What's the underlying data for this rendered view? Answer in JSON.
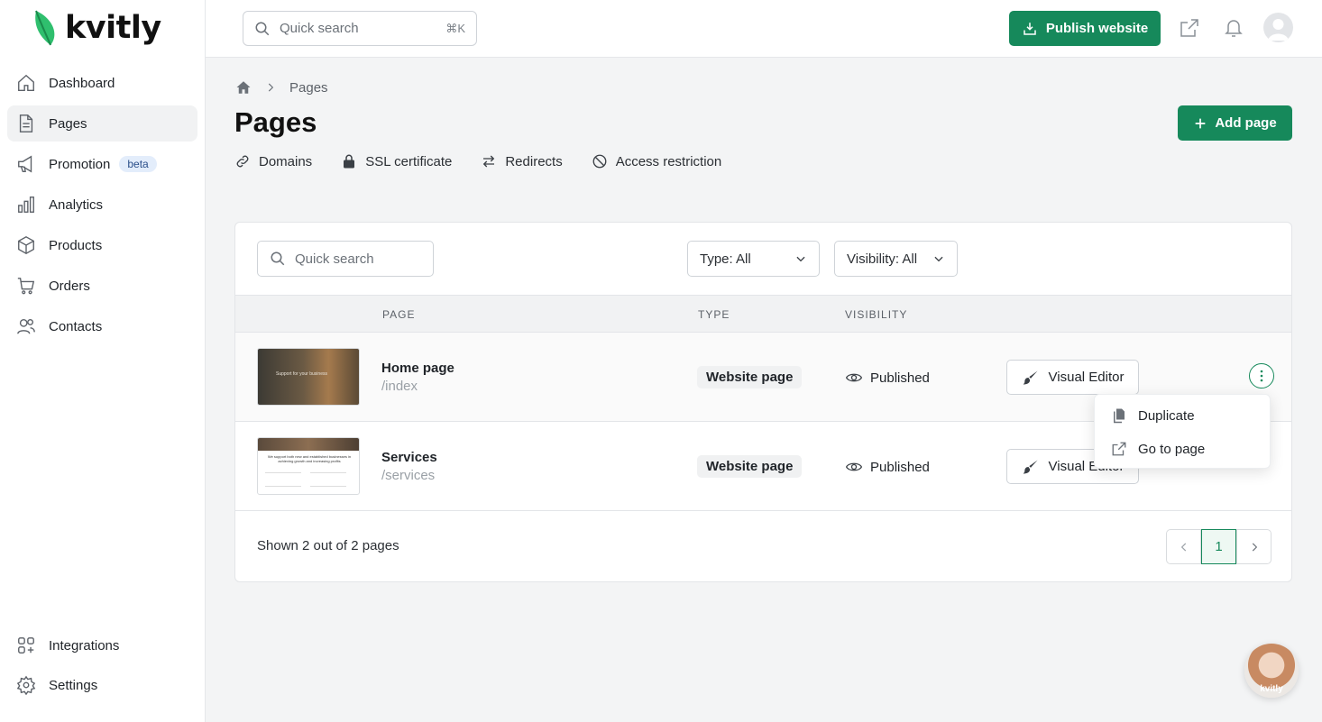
{
  "brand": {
    "name": "kvitly"
  },
  "sidebar": {
    "items": [
      {
        "label": "Dashboard"
      },
      {
        "label": "Pages"
      },
      {
        "label": "Promotion",
        "badge": "beta"
      },
      {
        "label": "Analytics"
      },
      {
        "label": "Products"
      },
      {
        "label": "Orders"
      },
      {
        "label": "Contacts"
      }
    ],
    "bottom": [
      {
        "label": "Integrations"
      },
      {
        "label": "Settings"
      }
    ]
  },
  "topbar": {
    "search_placeholder": "Quick search",
    "shortcut": "⌘K",
    "publish_label": "Publish website"
  },
  "breadcrumb": {
    "current": "Pages"
  },
  "page": {
    "title": "Pages",
    "add_label": "Add page",
    "subnav": [
      "Domains",
      "SSL certificate",
      "Redirects",
      "Access restriction"
    ]
  },
  "table": {
    "search_placeholder": "Quick search",
    "filters": {
      "type": "Type: All",
      "visibility": "Visibility: All"
    },
    "columns": [
      "PAGE",
      "TYPE",
      "VISIBILITY"
    ],
    "rows": [
      {
        "name": "Home page",
        "path": "/index",
        "type": "Website page",
        "visibility": "Published",
        "action": "Visual Editor",
        "thumb_text": "Support for your business"
      },
      {
        "name": "Services",
        "path": "/services",
        "type": "Website page",
        "visibility": "Published",
        "action": "Visual Editor",
        "thumb_text": "We support both new and established businesses in achieving growth and increasing profits"
      }
    ],
    "footer": "Shown 2 out of 2 pages",
    "pagination": {
      "current": "1"
    }
  },
  "row_menu": {
    "items": [
      "Duplicate",
      "Go to page"
    ]
  },
  "support_widget": {
    "label": "kvitly"
  },
  "colors": {
    "accent": "#16895b",
    "active_bg": "#f1f2f3"
  }
}
